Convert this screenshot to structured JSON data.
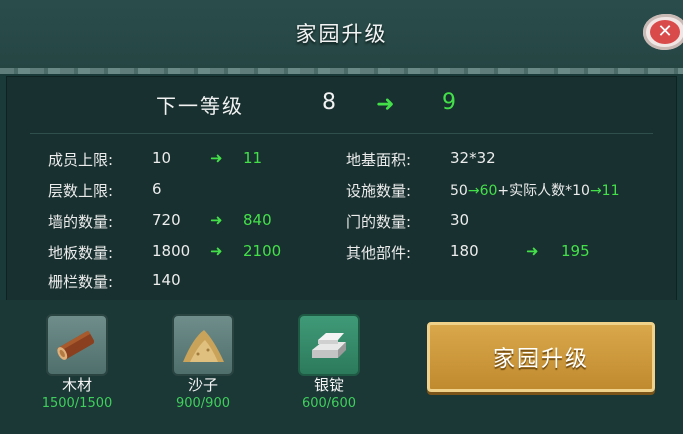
{
  "title": "家园升级",
  "level": {
    "label": "下一等级",
    "from": "8",
    "arrow": "➜",
    "to": "9"
  },
  "stats_left": [
    {
      "label": "成员上限:",
      "value": "10",
      "new": "11"
    },
    {
      "label": "层数上限:",
      "value": "6",
      "new": ""
    },
    {
      "label": "墙的数量:",
      "value": "720",
      "new": "840"
    },
    {
      "label": "地板数量:",
      "value": "1800",
      "new": "2100"
    },
    {
      "label": "栅栏数量:",
      "value": "140",
      "new": ""
    }
  ],
  "stats_right": [
    {
      "label": "地基面积:",
      "value": "32*32"
    },
    {
      "label": "设施数量:",
      "value_a": "50",
      "value_b": "60",
      "value_c": "+实际人数*10",
      "value_d": "11"
    },
    {
      "label": "门的数量:",
      "value": "30"
    },
    {
      "label": "其他部件:",
      "value": "180",
      "new": "195"
    }
  ],
  "arrow_small": "➜",
  "arrow_thin": "→",
  "resources": [
    {
      "name": "木材",
      "count": "1500/1500",
      "icon": "wood-icon"
    },
    {
      "name": "沙子",
      "count": "900/900",
      "icon": "sand-icon"
    },
    {
      "name": "银锭",
      "count": "600/600",
      "icon": "silver-ingot-icon"
    }
  ],
  "upgrade_button": "家园升级",
  "close_symbol": "✕",
  "colors": {
    "accent_green": "#44e04a",
    "button_gold": "#c99a3c",
    "panel": "#18302f"
  }
}
